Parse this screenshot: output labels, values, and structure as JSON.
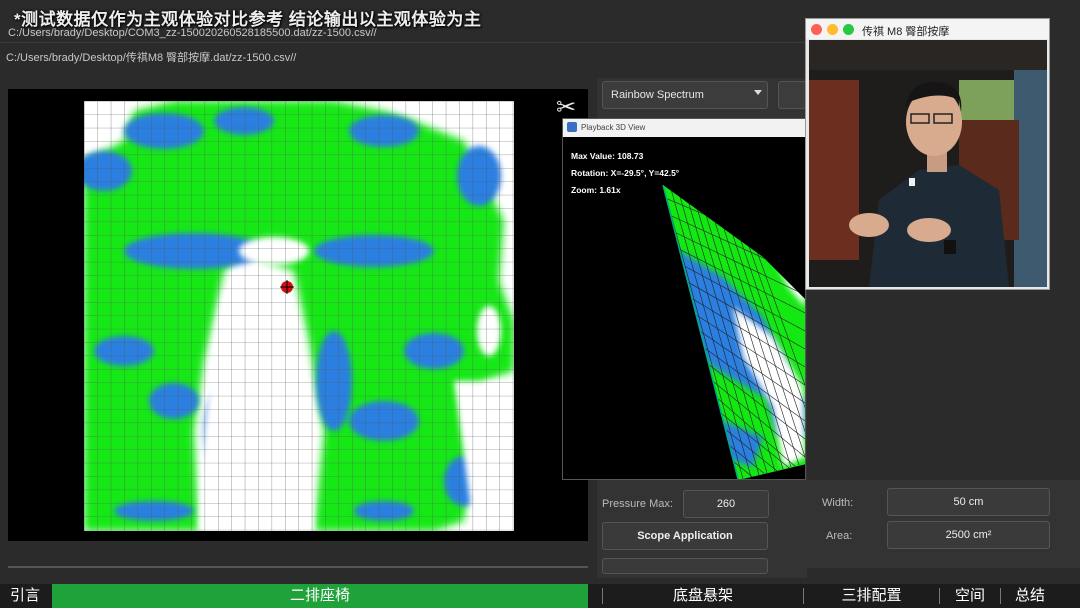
{
  "overlay": {
    "disclaimer": "*测试数据仅作为主观体验对比参考 结论输出以主观体验为主"
  },
  "paths": {
    "line1": "C:/Users/brady/Desktop/COM3_zz-150020260528185500.dat/zz-1500.csv//",
    "line2": "C:/Users/brady/Desktop/传祺M8 臀部按摩.dat/zz-1500.csv//"
  },
  "controls": {
    "spectrum_select": "Rainbow Spectrum",
    "pressure_max_label": "Pressure Max:",
    "pressure_max_value": "260",
    "scope_button": "Scope Application",
    "width_label": "Width:",
    "width_value": "50 cm",
    "area_label": "Area:",
    "area_value": "2500 cm²"
  },
  "view3d": {
    "title": "Playback 3D View",
    "max_value": "Max Value: 108.73",
    "rotation": "Rotation: X=-29.5°, Y=42.5°",
    "zoom": "Zoom: 1.61x"
  },
  "video": {
    "title": "传祺 M8 臀部按摩"
  },
  "bottom_nav": {
    "intro": "引言",
    "second_row": "二排座椅",
    "chassis": "底盘悬架",
    "third_row": "三排配置",
    "space": "空间",
    "summary": "总结"
  },
  "colors": {
    "low_pressure": "#ffffff",
    "mid_pressure": "#13e813",
    "high_pressure": "#2a7fe0",
    "active_nav": "#1fa23a"
  }
}
